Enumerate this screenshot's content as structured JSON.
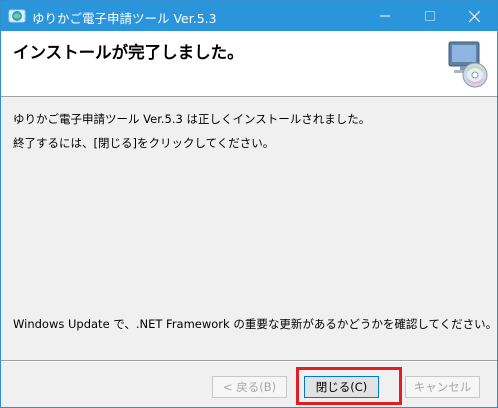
{
  "window": {
    "title": "ゆりかご電子申請ツール Ver.5.3",
    "icons": {
      "app": "app-globe-icon",
      "minimize": "minimize-icon",
      "maximize": "maximize-icon",
      "close": "close-icon"
    }
  },
  "header": {
    "title": "インストールが完了しました。",
    "icon": "computer-cd-icon"
  },
  "body": {
    "message1": "ゆりかご電子申請ツール Ver.5.3 は正しくインストールされました。",
    "message2": "終了するには、[閉じる]をクリックしてください。",
    "message3": "Windows Update で、.NET Framework の重要な更新があるかどうかを確認してください。"
  },
  "buttons": {
    "back": "< 戻る(B)",
    "close": "閉じる(C)",
    "cancel": "キャンセル"
  },
  "colors": {
    "titlebar": "#2b95dc",
    "highlight": "#e01e23"
  }
}
